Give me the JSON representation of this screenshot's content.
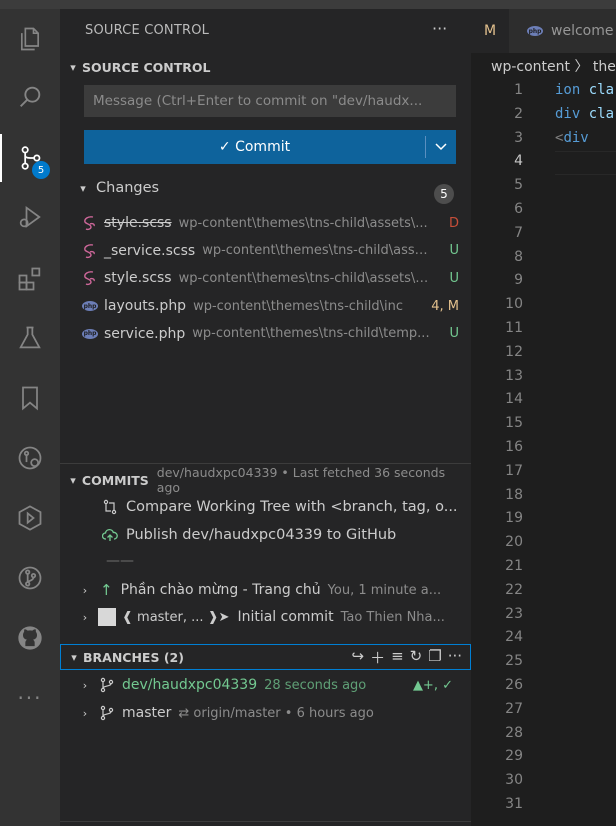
{
  "activity": {
    "scm_badge": "5",
    "items": [
      "explorer-icon",
      "search-icon",
      "source-control-icon",
      "run-debug-icon",
      "extensions-icon",
      "testing-icon",
      "bookmarks-icon",
      "git-graph-icon",
      "remote-explorer-icon",
      "gitlens-icon",
      "github-icon",
      "more-icon"
    ]
  },
  "sidebar": {
    "title": "SOURCE CONTROL",
    "more": "···",
    "scm_section": {
      "label": "SOURCE CONTROL",
      "message_placeholder": "Message (Ctrl+Enter to commit on \"dev/haudx...",
      "commit_label": "✓ Commit",
      "changes_label": "Changes",
      "changes_count": "5",
      "files": [
        {
          "name": "style.scss",
          "path": "wp-content\\themes\\tns-child\\assets\\...",
          "status": "D",
          "status_color": "#c74e39",
          "deleted": true,
          "icon": "sass-icon"
        },
        {
          "name": "_service.scss",
          "path": "wp-content\\themes\\tns-child\\asse...",
          "status": "U",
          "status_color": "#73c991",
          "deleted": false,
          "icon": "sass-icon"
        },
        {
          "name": "style.scss",
          "path": "wp-content\\themes\\tns-child\\assets\\s...",
          "status": "U",
          "status_color": "#73c991",
          "deleted": false,
          "icon": "sass-icon"
        },
        {
          "name": "layouts.php",
          "path": "wp-content\\themes\\tns-child\\inc",
          "status": "4, M",
          "status_color": "#e2c08d",
          "deleted": false,
          "icon": "php-icon"
        },
        {
          "name": "service.php",
          "path": "wp-content\\themes\\tns-child\\temp...",
          "status": "U",
          "status_color": "#73c991",
          "deleted": false,
          "icon": "php-icon"
        }
      ]
    },
    "commits": {
      "label": "COMMITS",
      "detail": "dev/haudxpc04339 • Last fetched 36 seconds ago",
      "compare": "Compare Working Tree with <branch, tag, o...",
      "publish": "Publish dev/haudxpc04339 to GitHub",
      "separator": "——",
      "items": [
        {
          "message": "Phần chào mừng - Trang chủ",
          "meta": "You, 1 minute a..."
        },
        {
          "refs": "❰ master, ... ❱➤",
          "message": "Initial commit",
          "meta": "Tao Thien Nha..."
        }
      ]
    },
    "branches": {
      "label": "BRANCHES (2)",
      "items": [
        {
          "name": "dev/haudxpc04339",
          "detail": "28 seconds ago",
          "status": "▲+, ✓",
          "color": "#73c991"
        },
        {
          "name": "master",
          "detail": "⇄  origin/master  •  6 hours ago",
          "status": "",
          "color": "#cccccc"
        }
      ]
    }
  },
  "editor": {
    "tab_partial": "M",
    "tab_welcome": "welcome",
    "breadcrumb": "wp-content 〉 the",
    "current_line": 4,
    "line_numbers": [
      "1",
      "2",
      "3",
      "4",
      "5",
      "6",
      "7",
      "8",
      "9",
      "10",
      "11",
      "12",
      "13",
      "14",
      "15",
      "16",
      "17",
      "18",
      "19",
      "20",
      "21",
      "22",
      "23",
      "24",
      "25",
      "26",
      "27",
      "28",
      "29",
      "30",
      "31"
    ],
    "code": {
      "l1_kw": "ion",
      "l1_at": " cla",
      "l2_kw": "div",
      "l2_at": " cla",
      "l3_tag": "  <",
      "l3_kw": "div"
    }
  }
}
